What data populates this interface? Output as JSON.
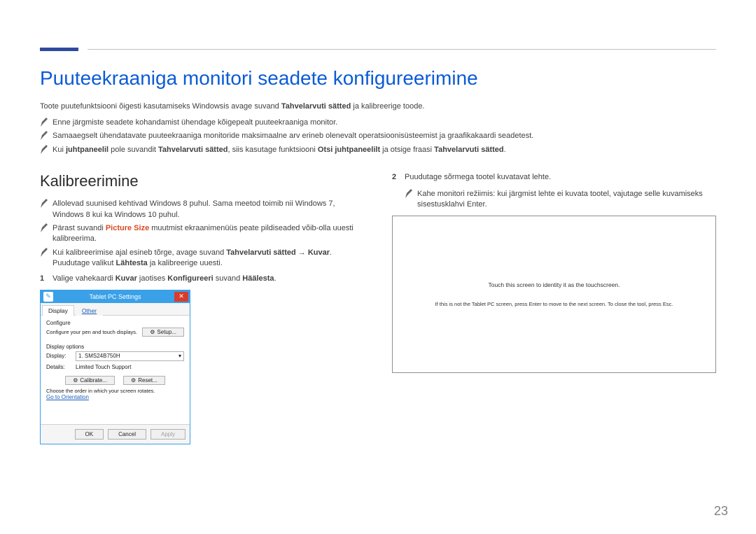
{
  "page": {
    "title": "Puuteekraaniga monitori seadete konfigureerimine",
    "intro_before_bold": "Toote puutefunktsiooni õigesti kasutamiseks Windowsis avage suvand ",
    "intro_bold": "Tahvelarvuti sätted",
    "intro_after_bold": " ja kalibreerige toode.",
    "number": "23"
  },
  "top_notes": {
    "n1": "Enne järgmiste seadete kohandamist ühendage kõigepealt puuteekraaniga monitor.",
    "n2": "Samaaegselt ühendatavate puuteekraaniga monitoride maksimaalne arv erineb olenevalt operatsioonisüsteemist ja graafikakaardi seadetest.",
    "n3_p1": "Kui ",
    "n3_b1": "juhtpaneelil",
    "n3_p2": " pole suvandit ",
    "n3_b2": "Tahvelarvuti sätted",
    "n3_p3": ", siis kasutage funktsiooni ",
    "n3_b3": "Otsi juhtpaneelilt",
    "n3_p4": " ja otsige fraasi ",
    "n3_b4": "Tahvelarvuti sätted",
    "n3_p5": "."
  },
  "left": {
    "heading": "Kalibreerimine",
    "note1": "Allolevad suunised kehtivad Windows 8 puhul. Sama meetod toimib nii Windows 7, Windows 8 kui ka Windows 10 puhul.",
    "note2_p1": "Pärast suvandi ",
    "note2_red": "Picture Size",
    "note2_p2": " muutmist ekraanimenüüs peate pildiseaded võib-olla uuesti kalibreerima.",
    "note3_p1": "Kui kalibreerimise ajal esineb tõrge, avage suvand ",
    "note3_b1": "Tahvelarvuti sätted",
    "note3_arrow": " → ",
    "note3_b2": "Kuvar",
    "note3_p2": ". Puudutage valikut ",
    "note3_b3": "Lähtesta",
    "note3_p3": " ja kalibreerige uuesti.",
    "step1_num": "1",
    "step1_p1": "Valige vahekaardi ",
    "step1_b1": "Kuvar",
    "step1_p2": " jaotises ",
    "step1_b2": "Konfigureeri",
    "step1_p3": " suvand ",
    "step1_b3": "Häälesta",
    "step1_p4": "."
  },
  "dialog": {
    "title": "Tablet PC Settings",
    "tab_display": "Display",
    "tab_other": "Other",
    "configure_label": "Configure",
    "configure_text": "Configure your pen and touch displays.",
    "setup_btn": "Setup...",
    "display_options": "Display options",
    "display_label": "Display:",
    "display_value": "1. SMS24B750H",
    "details_label": "Details:",
    "details_value": "Limited Touch Support",
    "calibrate_btn": "Calibrate...",
    "reset_btn": "Reset...",
    "orient_text": "Choose the order in which your screen rotates.",
    "orient_link": "Go to Orientation",
    "ok": "OK",
    "cancel": "Cancel",
    "apply": "Apply"
  },
  "right": {
    "step2_num": "2",
    "step2_text": "Puudutage sõrmega tootel kuvatavat lehte.",
    "note": "Kahe monitori režiimis: kui järgmist lehte ei kuvata tootel, vajutage selle kuvamiseks sisestusklahvi Enter.",
    "touch_line1": "Touch this screen to identity it as the touchscreen.",
    "touch_line2": "If this is not the Tablet PC screen, press Enter to move to the next screen. To close the tool, press Esc."
  }
}
